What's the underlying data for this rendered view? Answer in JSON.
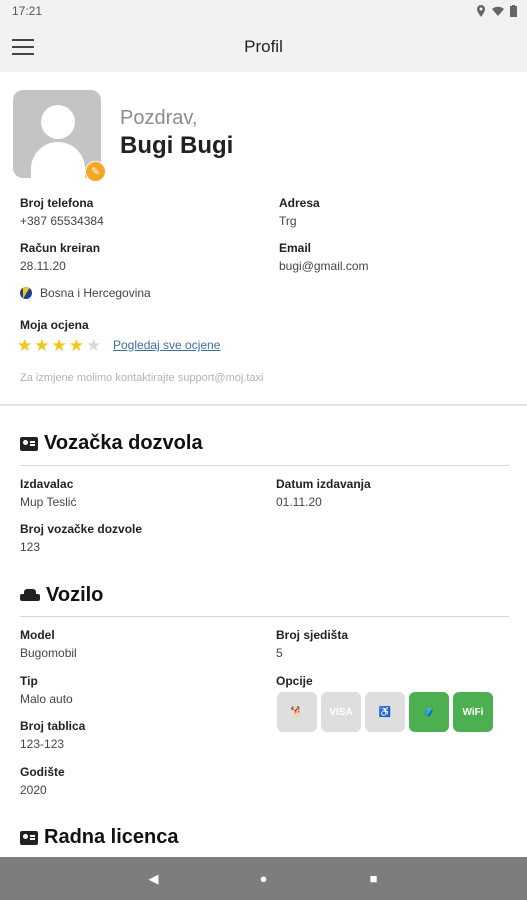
{
  "status_bar": {
    "time": "17:21"
  },
  "app_bar": {
    "title": "Profil"
  },
  "profile": {
    "greeting": "Pozdrav,",
    "name": "Bugi Bugi",
    "phone_label": "Broj telefona",
    "phone": "+387 65534384",
    "address_label": "Adresa",
    "address": "Trg",
    "created_label": "Račun kreiran",
    "created": "28.11.20",
    "email_label": "Email",
    "email": "bugi@gmail.com",
    "country": "Bosna i Hercegovina",
    "rating_label": "Moja ocjena",
    "rating": 4,
    "rating_max": 5,
    "see_all_ratings": "Pogledaj sve ocjene",
    "support_note": "Za izmjene molimo kontaktirajte support@moj.taxi"
  },
  "license": {
    "title": "Vozačka dozvola",
    "issuer_label": "Izdavalac",
    "issuer": "Mup Teslić",
    "issue_date_label": "Datum izdavanja",
    "issue_date": "01.11.20",
    "number_label": "Broj vozačke dozvole",
    "number": "123"
  },
  "vehicle": {
    "title": "Vozilo",
    "model_label": "Model",
    "model": "Bugomobil",
    "seats_label": "Broj sjedišta",
    "seats": "5",
    "type_label": "Tip",
    "type": "Malo auto",
    "options_label": "Opcije",
    "plates_label": "Broj tablica",
    "plates": "123-123",
    "year_label": "Godište",
    "year": "2020",
    "options": [
      {
        "name": "pet-icon",
        "enabled": false
      },
      {
        "name": "visa-icon",
        "label": "VISA",
        "enabled": false
      },
      {
        "name": "wheelchair-icon",
        "enabled": false
      },
      {
        "name": "luggage-icon",
        "enabled": true
      },
      {
        "name": "wifi-icon",
        "label": "WiFi",
        "enabled": true
      }
    ]
  },
  "work_license": {
    "title": "Radna licenca"
  },
  "colors": {
    "accent_green": "#4caf50",
    "star": "#f5c518",
    "edit_badge": "#f5a623"
  }
}
